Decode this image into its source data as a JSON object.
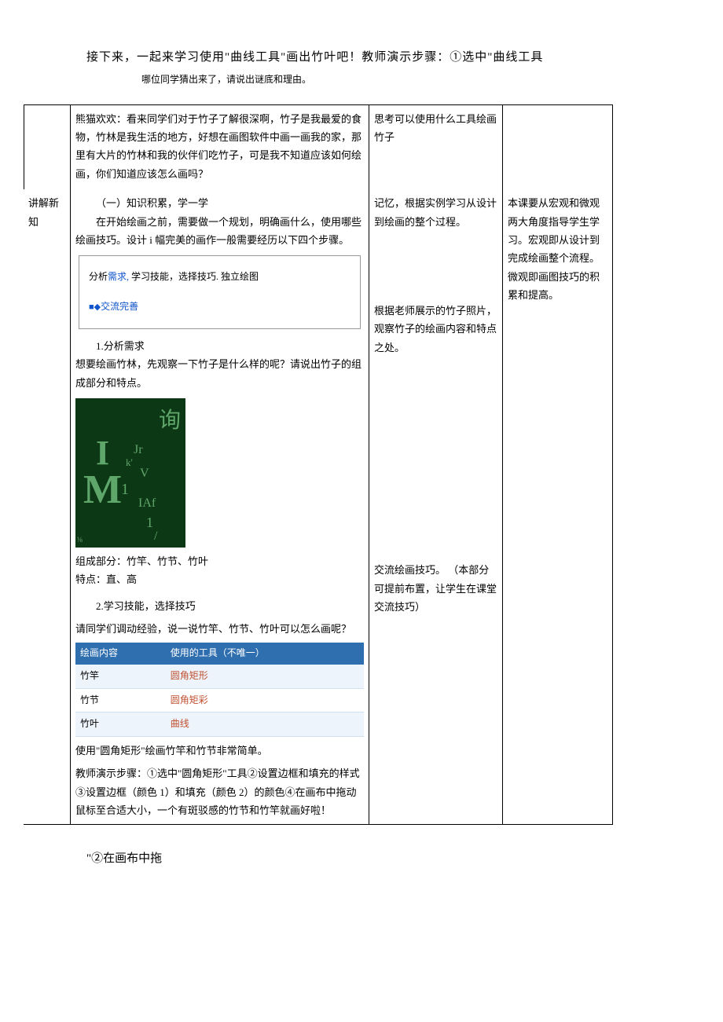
{
  "top_line": "接下来，一起来学习使用\"曲线工具\"画出竹叶吧！教师演示步骤：①选中\"曲线工具",
  "top_line_2": "哪位同学猜出来了，请说出谜底和理由。",
  "grid": {
    "row0": {
      "col3": "思考可以使用什么工具绘画竹子"
    },
    "panda": "熊猫欢欢：看来同学们对于竹子了解很深啊，竹子是我最爱的食物，竹林是我生活的地方，好想在画图软件中画一画我的家，那里有大片的竹林和我的伙伴们吃竹子，可是我不知道应该如何绘画，你们知道应该怎么画吗？",
    "col1_label_a": "讲解新",
    "col1_label_b": "知",
    "col2": {
      "section_title": "（一）知识积累，学一学",
      "intro": "在开始绘画之前，需要做一个规划，明确画什么，使用哪些绘画技巧。设计 i 幅完美的画作一般需要经历以下四个步骤。",
      "steps_box_line1_a": "分析",
      "steps_box_line1_link": "需求,",
      "steps_box_line1_b": "学习技能，选择技巧. 独立绘图",
      "steps_box_line2_marker": "■◆",
      "steps_box_line2_text": "交流完善",
      "sub1_title": "1.分析需求",
      "sub1_body_a": "想要绘画竹林，先观察一下竹子是什么样的呢？请说出竹子的组成部分和特点。",
      "bamboo_glyphs": {
        "a": "询",
        "b": "I",
        "c": "M",
        "d": "Jr",
        "e": "k'",
        "f": "V",
        "g": "1",
        "h": "IAf",
        "i": "1",
        "j": "/",
        "frac": "⅛"
      },
      "parts_line": "组成部分：竹竿、竹节、竹叶",
      "feat_line": "特点：直、高",
      "sub2_title": "2.学习技能，选择技巧",
      "sub2_body": "请同学们调动经验，说一说竹竿、竹节、竹叶可以怎么画呢？",
      "table": {
        "h1": "绘画内容",
        "h2": "使用的工具（不唯一）",
        "rows": [
          {
            "name": "竹竿",
            "tool": "圆角矩形"
          },
          {
            "name": "竹节",
            "tool": "圆角矩彩"
          },
          {
            "name": "竹叶",
            "tool": "曲线"
          }
        ]
      },
      "after_a": "使用\"圆角矩形\"绘画竹竿和竹节非常简单。",
      "after_b": "教师演示步骤：①选中\"圆角矩形\"工具②设置边框和填充的样式③设置边框（颜色 1）和填充（颜色 2）的颜色④在画布中拖动鼠标至合适大小，一个有斑驳感的竹节和竹竿就画好啦！"
    },
    "col3": {
      "a": "记忆，根据实例学习从设计到绘画的整个过程。",
      "b": "根据老师展示的竹子照片，观察竹子的绘画内容和特点之处。",
      "c": "交流绘画技巧。 （本部分可提前布置，让学生在课堂交流技巧）"
    },
    "col4": {
      "a": "本课要从宏观和微观两大角度指导学生学习。宏观即从设计到完成绘画整个流程。微观即画图技巧的积累和提高。"
    }
  },
  "bottom_line": "\"②在画布中拖"
}
